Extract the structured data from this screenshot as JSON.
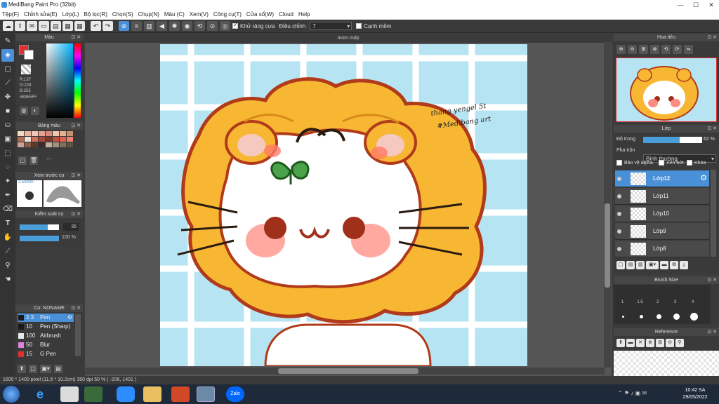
{
  "app": {
    "title": "MediBang Paint Pro (32bit)"
  },
  "menu": [
    "Tệp(F)",
    "Chỉnh sửa(E)",
    "Lớp(L)",
    "Bộ lọc(R)",
    "Chọn(S)",
    "Chụp(N)",
    "Màu (C)",
    "Xem(V)",
    "Công cụ(T)",
    "Cửa sổ(W)",
    "Cloud",
    "Help"
  ],
  "toolbar": {
    "antialias_label": "Khử răng cưa",
    "adjust_label": "Điều chỉnh",
    "adjust_value": "7",
    "smooth_edge_label": "Cạnh mềm"
  },
  "panels": {
    "color": {
      "title": "Màu",
      "r": "R:137",
      "g": "G:229",
      "b": "B:255",
      "hex": "#89E5FF",
      "fg": "#e03030",
      "bg": "#ffffff"
    },
    "palette": {
      "title": "Bảng màu",
      "value": "---"
    },
    "preview": {
      "title": "Xem trước cọ",
      "size": "2.59mm"
    },
    "brush_ctrl": {
      "title": "Kiểm soát cọ",
      "size": "35",
      "opacity": "100 %"
    },
    "brushes": {
      "title": "Cọ: NONAME",
      "items": [
        {
          "size": "2.3",
          "name": "Pen",
          "color": "#1a1a1a"
        },
        {
          "size": "10",
          "name": "Pen (Sharp)",
          "color": "#1a1a1a"
        },
        {
          "size": "100",
          "name": "Airbrush",
          "color": "#e8e8e8"
        },
        {
          "size": "50",
          "name": "Blur",
          "color": "#e080e0"
        },
        {
          "size": "15",
          "name": "G Pen",
          "color": "#e03030"
        }
      ]
    },
    "navigator": {
      "title": "Hoa tiêu"
    },
    "layer": {
      "title": "Lớp",
      "opacity_label": "Độ trong",
      "opacity_value": "62 %",
      "blend_label": "Pha trộn",
      "blend_value": "Bình thường",
      "protect_alpha": "Bảo vệ alpha",
      "clipping": "Xén bớt",
      "lock": "Khóa",
      "layers": [
        "Lớp12",
        "Lớp11",
        "Lớp10",
        "Lớp9",
        "Lớp8"
      ]
    },
    "brush_size": {
      "title": "Brush Size",
      "labels": [
        "1",
        "1.5",
        "2",
        "3",
        "4"
      ]
    },
    "reference": {
      "title": "Reference"
    }
  },
  "canvas": {
    "tab": "mom.mdp",
    "signature_line1": "thang yengel 5t",
    "signature_line2": "#Medibang art"
  },
  "status": {
    "text": "1600 * 1400 pixel   (11.6 * 10.2cm)   350 dpi   50 %   ( -206, 1401 )"
  },
  "taskbar": {
    "time": "10:42 SA",
    "date": "29/05/2022",
    "zalo": "Zalo"
  }
}
